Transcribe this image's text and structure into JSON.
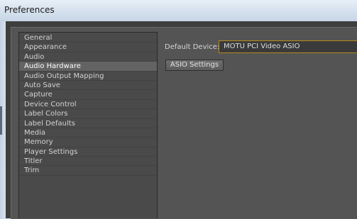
{
  "window": {
    "title": "Preferences"
  },
  "sidebar": {
    "selected": "Audio Hardware",
    "items": [
      {
        "label": "General"
      },
      {
        "label": "Appearance"
      },
      {
        "label": "Audio"
      },
      {
        "label": "Audio Hardware"
      },
      {
        "label": "Audio Output Mapping"
      },
      {
        "label": "Auto Save"
      },
      {
        "label": "Capture"
      },
      {
        "label": "Device Control"
      },
      {
        "label": "Label Colors"
      },
      {
        "label": "Label Defaults"
      },
      {
        "label": "Media"
      },
      {
        "label": "Memory"
      },
      {
        "label": "Player Settings"
      },
      {
        "label": "Titler"
      },
      {
        "label": "Trim"
      }
    ]
  },
  "audio_hardware": {
    "default_device_label": "Default Device:",
    "default_device_value": "MOTU PCI Video ASIO",
    "asio_settings_label": "ASIO Settings"
  },
  "colors": {
    "background": "#3e3e3e",
    "panel": "#545454",
    "selected_item": "#636363",
    "focus_border": "#b8891c"
  }
}
